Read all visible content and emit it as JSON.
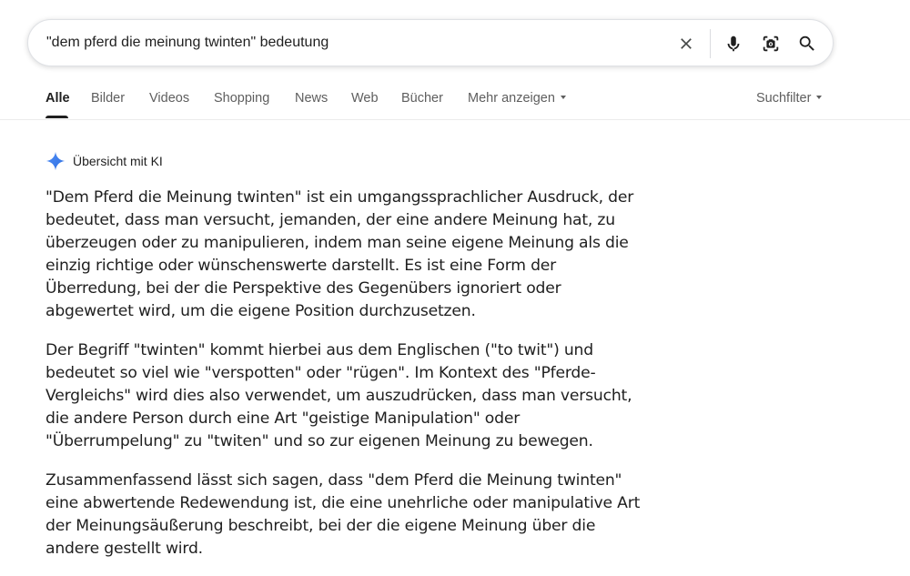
{
  "search": {
    "query": "\"dem pferd die meinung twinten\" bedeutung"
  },
  "tabs": [
    {
      "label": "Alle",
      "active": true
    },
    {
      "label": "Bilder"
    },
    {
      "label": "Videos"
    },
    {
      "label": "Shopping"
    },
    {
      "label": "News"
    },
    {
      "label": "Web"
    },
    {
      "label": "Bücher"
    },
    {
      "label": "Mehr anzeigen"
    }
  ],
  "filter": {
    "label": "Suchfilter"
  },
  "ai_overview": {
    "title": "Übersicht mit KI",
    "paragraphs": [
      "\"Dem Pferd die Meinung twinten\" ist ein umgangssprachlicher Ausdruck, der bedeutet, dass man versucht, jemanden, der eine andere Meinung hat, zu überzeugen oder zu manipulieren, indem man seine eigene Meinung als die einzig richtige oder wünschenswerte darstellt. Es ist eine Form der Überredung, bei der die Perspektive des Gegenübers ignoriert oder abgewertet wird, um die eigene Position durchzusetzen.",
      "Der Begriff \"twinten\" kommt hierbei aus dem Englischen (\"to twit\") und bedeutet so viel wie \"verspotten\" oder \"rügen\". Im Kontext des \"Pferde-Vergleichs\" wird dies also verwendet, um auszudrücken, dass man versucht, die andere Person durch eine Art \"geistige Manipulation\" oder \"Überrumpelung\" zu \"twiten\" und so zur eigenen Meinung zu bewegen.",
      "Zusammenfassend lässt sich sagen, dass \"dem Pferd die Meinung twinten\" eine abwertende Redewendung ist, die eine unehrliche oder manipulative Art der Meinungsäußerung beschreibt, bei der die eigene Meinung über die andere gestellt wird."
    ]
  },
  "icons": {
    "clear": "close-icon",
    "mic": "microphone-icon",
    "lens": "camera-lens-icon",
    "search": "search-icon",
    "ai": "sparkle-icon"
  },
  "colors": {
    "ai_sparkle": "#4285f4",
    "text": "#1f1f1f",
    "muted": "#5e5e5e"
  }
}
